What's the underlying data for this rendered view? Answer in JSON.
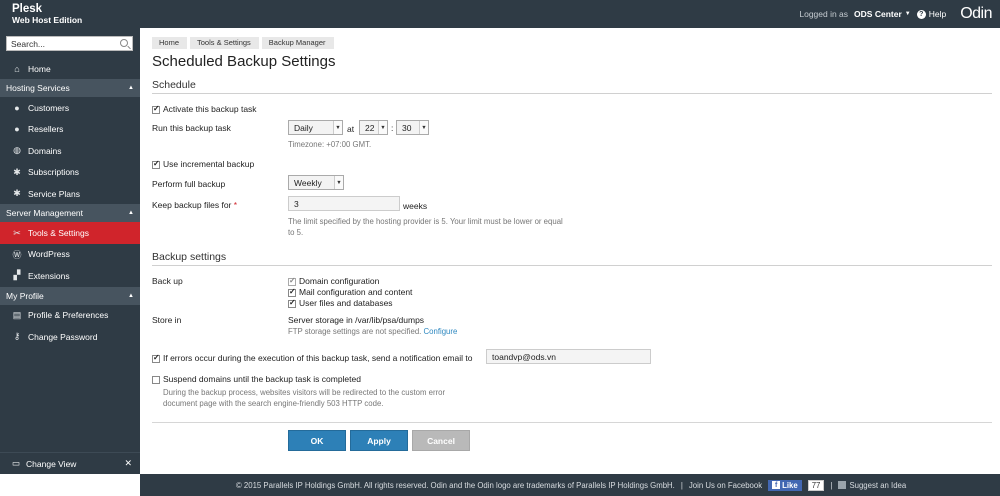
{
  "header": {
    "brand_line1": "Plesk",
    "brand_line2": "Web Host Edition",
    "logged_in_as": "Logged in as",
    "user_name": "ODS Center",
    "help": "Help",
    "logo": "Odin"
  },
  "sidebar": {
    "search_placeholder": "Search...",
    "home": "Home",
    "groups": [
      {
        "title": "Hosting Services",
        "items": [
          "Customers",
          "Resellers",
          "Domains",
          "Subscriptions",
          "Service Plans"
        ]
      },
      {
        "title": "Server Management",
        "items": [
          "Tools & Settings",
          "WordPress",
          "Extensions"
        ]
      },
      {
        "title": "My Profile",
        "items": [
          "Profile & Preferences",
          "Change Password"
        ]
      }
    ],
    "change_view": "Change View"
  },
  "breadcrumbs": [
    "Home",
    "Tools & Settings",
    "Backup Manager"
  ],
  "page_title": "Scheduled Backup Settings",
  "schedule": {
    "section_title": "Schedule",
    "activate_label": "Activate this backup task",
    "activate_checked": true,
    "run_label": "Run this backup task",
    "frequency": "Daily",
    "at_label": "at",
    "hour": "22",
    "colon": ":",
    "minute": "30",
    "timezone": "Timezone: +07:00 GMT.",
    "incremental_label": "Use incremental backup",
    "incremental_checked": true,
    "full_backup_label": "Perform full backup",
    "full_backup_value": "Weekly",
    "keep_label": "Keep backup files for",
    "required_mark": "*",
    "keep_value": "3",
    "keep_unit": "weeks",
    "limit_hint_line1": "The limit specified by the hosting provider is 5. Your limit must be lower or equal",
    "limit_hint_line2": "to 5."
  },
  "backup_settings": {
    "section_title": "Backup settings",
    "backup_label": "Back up",
    "options": [
      "Domain configuration",
      "Mail configuration and content",
      "User files and databases"
    ],
    "store_label": "Store in",
    "store_value": "Server storage in /var/lib/psa/dumps",
    "ftp_note": "FTP storage settings are not specified.",
    "configure_link": "Configure",
    "notify_label": "If errors occur during the execution of this backup task, send a notification email to",
    "notify_checked": true,
    "notify_email": "toandvp@ods.vn",
    "suspend_label": "Suspend domains until the backup task is completed",
    "suspend_checked": false,
    "suspend_hint_line1": "During the backup process, websites visitors will be redirected to the custom error",
    "suspend_hint_line2": "document page with the search engine-friendly 503 HTTP code."
  },
  "buttons": {
    "ok": "OK",
    "apply": "Apply",
    "cancel": "Cancel"
  },
  "footer": {
    "copyright": "© 2015 Parallels IP Holdings GmbH. All rights reserved. Odin and the Odin logo are trademarks of Parallels IP Holdings GmbH.",
    "separator": "|",
    "join_us": "Join Us on Facebook",
    "like": "Like",
    "like_count": "77",
    "suggest": "Suggest an Idea"
  }
}
